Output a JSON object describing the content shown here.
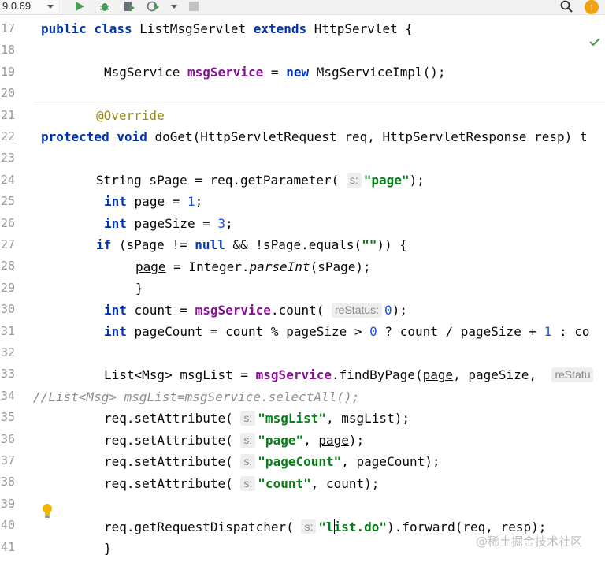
{
  "toolbar": {
    "run_config_label": "9.0.69",
    "icons": [
      "run-icon",
      "debug-icon",
      "coverage-icon",
      "profile-icon",
      "chevron-down-icon",
      "stop-icon",
      "search-icon",
      "update-icon"
    ],
    "update_badge": "↑"
  },
  "editor": {
    "line_numbers": [
      "17",
      "18",
      "19",
      "20",
      "21",
      "22",
      "23",
      "24",
      "25",
      "26",
      "27",
      "28",
      "29",
      "30",
      "31",
      "32",
      "33",
      "34",
      "35",
      "36",
      "37",
      "38",
      "39",
      "40",
      "41"
    ],
    "hint_s": "s:",
    "hint_restatus": "reStatus:",
    "line17": {
      "kw1": "public",
      "kw2": "class",
      "cls": " ListMsgServlet ",
      "kw3": "extends",
      "rest": " HttpServlet {"
    },
    "line19": {
      "type": "MsgService ",
      "field": "msgService",
      "eq": " = ",
      "kw": "new",
      "rest": " MsgServiceImpl();"
    },
    "line21": {
      "ann": "@Override"
    },
    "line22": {
      "kw1": "protected",
      "kw2": "void",
      "rest": " doGet(HttpServletRequest req, HttpServletResponse resp) t"
    },
    "line24": {
      "pre": "String sPage = req.getParameter(",
      "str": "\"page\"",
      "post": ");"
    },
    "line25": {
      "kw": "int",
      "var": "page",
      "eq": " = ",
      "num": "1",
      "end": ";"
    },
    "line26": {
      "kw": "int",
      "rest": " pageSize = ",
      "num": "3",
      "end": ";"
    },
    "line27": {
      "kw": "if",
      "p1": " (sPage != ",
      "kw2": "null",
      "p2": " && !sPage.equals(",
      "str": "\"\"",
      "p3": ")) {"
    },
    "line28": {
      "var": "page",
      "p1": " = Integer.",
      "method": "parseInt",
      "p2": "(sPage);"
    },
    "line29": {
      "text": "}"
    },
    "line30": {
      "kw": "int",
      "p1": " count = ",
      "field": "msgService",
      "p2": ".count(",
      "num": "0",
      "end": ");"
    },
    "line31": {
      "kw": "int",
      "p1": " pageCount = count % pageSize > ",
      "n1": "0",
      "p2": " ? count / pageSize + ",
      "n2": "1",
      "p3": " : co"
    },
    "line33": {
      "p1": "List<Msg> msgList = ",
      "field": "msgService",
      "p2": ".findByPage(",
      "var": "page",
      "p3": ", pageSize, ",
      "hint": "reStatu"
    },
    "line34": {
      "comment": "//List<Msg> msgList=msgService.selectAll();"
    },
    "line35": {
      "pre": "req.setAttribute(",
      "str": "\"msgList\"",
      "post": ", msgList);"
    },
    "line36": {
      "pre": "req.setAttribute(",
      "str": "\"page\"",
      "mid": ", ",
      "var": "page",
      "post": ");"
    },
    "line37": {
      "pre": "req.setAttribute(",
      "str": "\"pageCount\"",
      "post": ", pageCount);"
    },
    "line38": {
      "pre": "req.setAttribute(",
      "str": "\"count\"",
      "post": ", count);"
    },
    "line40": {
      "pre": "req.getRequestDispatcher(",
      "str1": "\"l",
      "str2": "ist.do\"",
      "post": ").forward(req, resp);"
    },
    "line41": {
      "text": "}"
    }
  },
  "watermark": "@稀土掘金技术社区"
}
